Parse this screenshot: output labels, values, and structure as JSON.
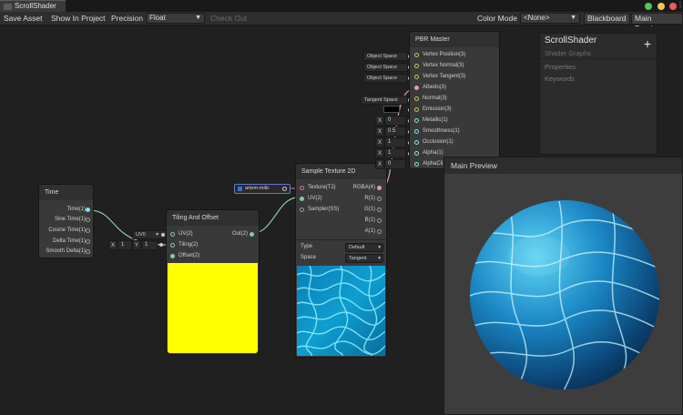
{
  "window": {
    "tab_title": "ScrollShader",
    "colors": {
      "close": "#ef5a5a",
      "minimize": "#f3c54e",
      "maximize": "#59c15a"
    }
  },
  "toolbar": {
    "save_asset": "Save Asset",
    "show_in_project": "Show In Project",
    "precision_label": "Precision",
    "precision_value": "Float",
    "check_out": "Check Out",
    "color_mode_label": "Color Mode",
    "color_mode_value": "<None>",
    "blackboard": "Blackboard",
    "main_preview": "Main Preview"
  },
  "time_node": {
    "title": "Time",
    "outputs": [
      "Time(1)",
      "Sine Time(1)",
      "Cosine Time(1)",
      "Delta Time(1)",
      "Smooth Delta(1)"
    ]
  },
  "tiling_node": {
    "title": "Tiling And Offset",
    "inputs": [
      "UV(2)",
      "Tiling(2)",
      "Offset(2)"
    ],
    "output": "Out(2)",
    "uv_select": "UV0",
    "tiling_x_label": "X",
    "tiling_x": "1",
    "tiling_y_label": "Y",
    "tiling_y": "1",
    "preview_color": "#ffff00"
  },
  "sample_node": {
    "title": "Sample Texture 2D",
    "inputs": [
      "Texture(T2)",
      "UV(2)",
      "Sampler(SS)"
    ],
    "outputs": [
      "RGBA(4)",
      "R(1)",
      "G(1)",
      "B(1)",
      "A(1)"
    ],
    "texture_field": "artem-milic",
    "type_label": "Type",
    "type_value": "Default",
    "space_label": "Space",
    "space_value": "Tangent"
  },
  "pbr_node": {
    "title": "PBR Master",
    "inputs": [
      "Vertex Position(3)",
      "Vertex Normal(3)",
      "Vertex Tangent(3)",
      "Albedo(3)",
      "Normal(3)",
      "Emission(3)",
      "Metallic(1)",
      "Smoothness(1)",
      "Occlusion(1)",
      "Alpha(1)",
      "AlphaCli"
    ],
    "object_space": [
      "Object Space",
      "Object Space",
      "Object Space"
    ],
    "tangent_space": "Tangent Space",
    "x_label": "X",
    "values": [
      "0",
      "0.5",
      "1",
      "1",
      "0"
    ]
  },
  "blackboard": {
    "title": "ScrollShader",
    "subtitle": "Shader Graphs",
    "properties": "Properties",
    "keywords": "Keywords"
  },
  "preview": {
    "title": "Main Preview"
  }
}
